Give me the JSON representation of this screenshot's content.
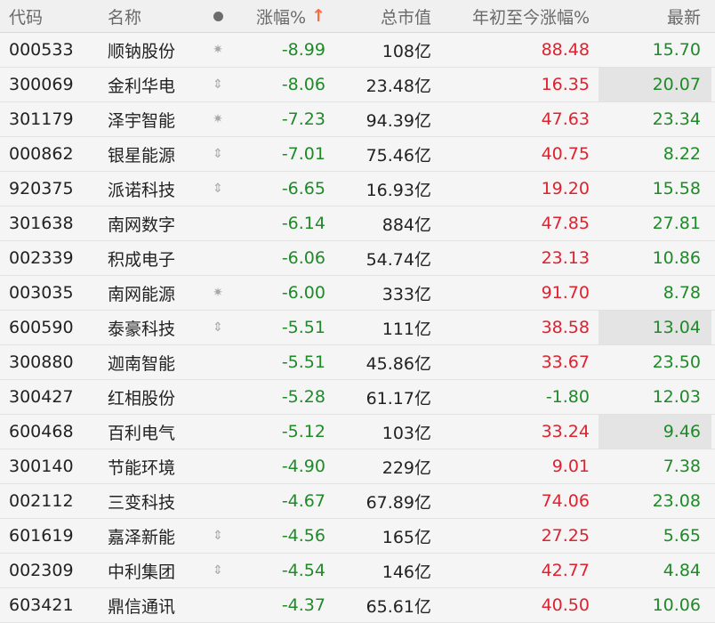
{
  "header": {
    "code": "代码",
    "name": "名称",
    "change": "涨幅%",
    "sort_arrow": "↑",
    "mcap": "总市值",
    "ytd": "年初至今涨幅%",
    "last": "最新"
  },
  "rows": [
    {
      "code": "000533",
      "name": "顺钠股份",
      "mark": "✷",
      "change": "-8.99",
      "mcap": "108亿",
      "ytd": "88.48",
      "last": "15.70"
    },
    {
      "code": "300069",
      "name": "金利华电",
      "mark": "⇕",
      "change": "-8.06",
      "mcap": "23.48亿",
      "ytd": "16.35",
      "last": "20.07"
    },
    {
      "code": "301179",
      "name": "泽宇智能",
      "mark": "✷",
      "change": "-7.23",
      "mcap": "94.39亿",
      "ytd": "47.63",
      "last": "23.34"
    },
    {
      "code": "000862",
      "name": "银星能源",
      "mark": "⇕",
      "change": "-7.01",
      "mcap": "75.46亿",
      "ytd": "40.75",
      "last": "8.22"
    },
    {
      "code": "920375",
      "name": "派诺科技",
      "mark": "⇕",
      "change": "-6.65",
      "mcap": "16.93亿",
      "ytd": "19.20",
      "last": "15.58"
    },
    {
      "code": "301638",
      "name": "南网数字",
      "mark": "",
      "change": "-6.14",
      "mcap": "884亿",
      "ytd": "47.85",
      "last": "27.81"
    },
    {
      "code": "002339",
      "name": "积成电子",
      "mark": "",
      "change": "-6.06",
      "mcap": "54.74亿",
      "ytd": "23.13",
      "last": "10.86"
    },
    {
      "code": "003035",
      "name": "南网能源",
      "mark": "✷",
      "change": "-6.00",
      "mcap": "333亿",
      "ytd": "91.70",
      "last": "8.78"
    },
    {
      "code": "600590",
      "name": "泰豪科技",
      "mark": "⇕",
      "change": "-5.51",
      "mcap": "111亿",
      "ytd": "38.58",
      "last": "13.04"
    },
    {
      "code": "300880",
      "name": "迦南智能",
      "mark": "",
      "change": "-5.51",
      "mcap": "45.86亿",
      "ytd": "33.67",
      "last": "23.50"
    },
    {
      "code": "300427",
      "name": "红相股份",
      "mark": "",
      "change": "-5.28",
      "mcap": "61.17亿",
      "ytd": "-1.80",
      "last": "12.03"
    },
    {
      "code": "600468",
      "name": "百利电气",
      "mark": "",
      "change": "-5.12",
      "mcap": "103亿",
      "ytd": "33.24",
      "last": "9.46"
    },
    {
      "code": "300140",
      "name": "节能环境",
      "mark": "",
      "change": "-4.90",
      "mcap": "229亿",
      "ytd": "9.01",
      "last": "7.38"
    },
    {
      "code": "002112",
      "name": "三变科技",
      "mark": "",
      "change": "-4.67",
      "mcap": "67.89亿",
      "ytd": "74.06",
      "last": "23.08"
    },
    {
      "code": "601619",
      "name": "嘉泽新能",
      "mark": "⇕",
      "change": "-4.56",
      "mcap": "165亿",
      "ytd": "27.25",
      "last": "5.65"
    },
    {
      "code": "002309",
      "name": "中利集团",
      "mark": "⇕",
      "change": "-4.54",
      "mcap": "146亿",
      "ytd": "42.77",
      "last": "4.84"
    },
    {
      "code": "603421",
      "name": "鼎信通讯",
      "mark": "",
      "change": "-4.37",
      "mcap": "65.61亿",
      "ytd": "40.50",
      "last": "10.06"
    }
  ],
  "colors": {
    "down": "#1e8a28",
    "up": "#e0212f",
    "sort_arrow": "#ff6a3d"
  }
}
